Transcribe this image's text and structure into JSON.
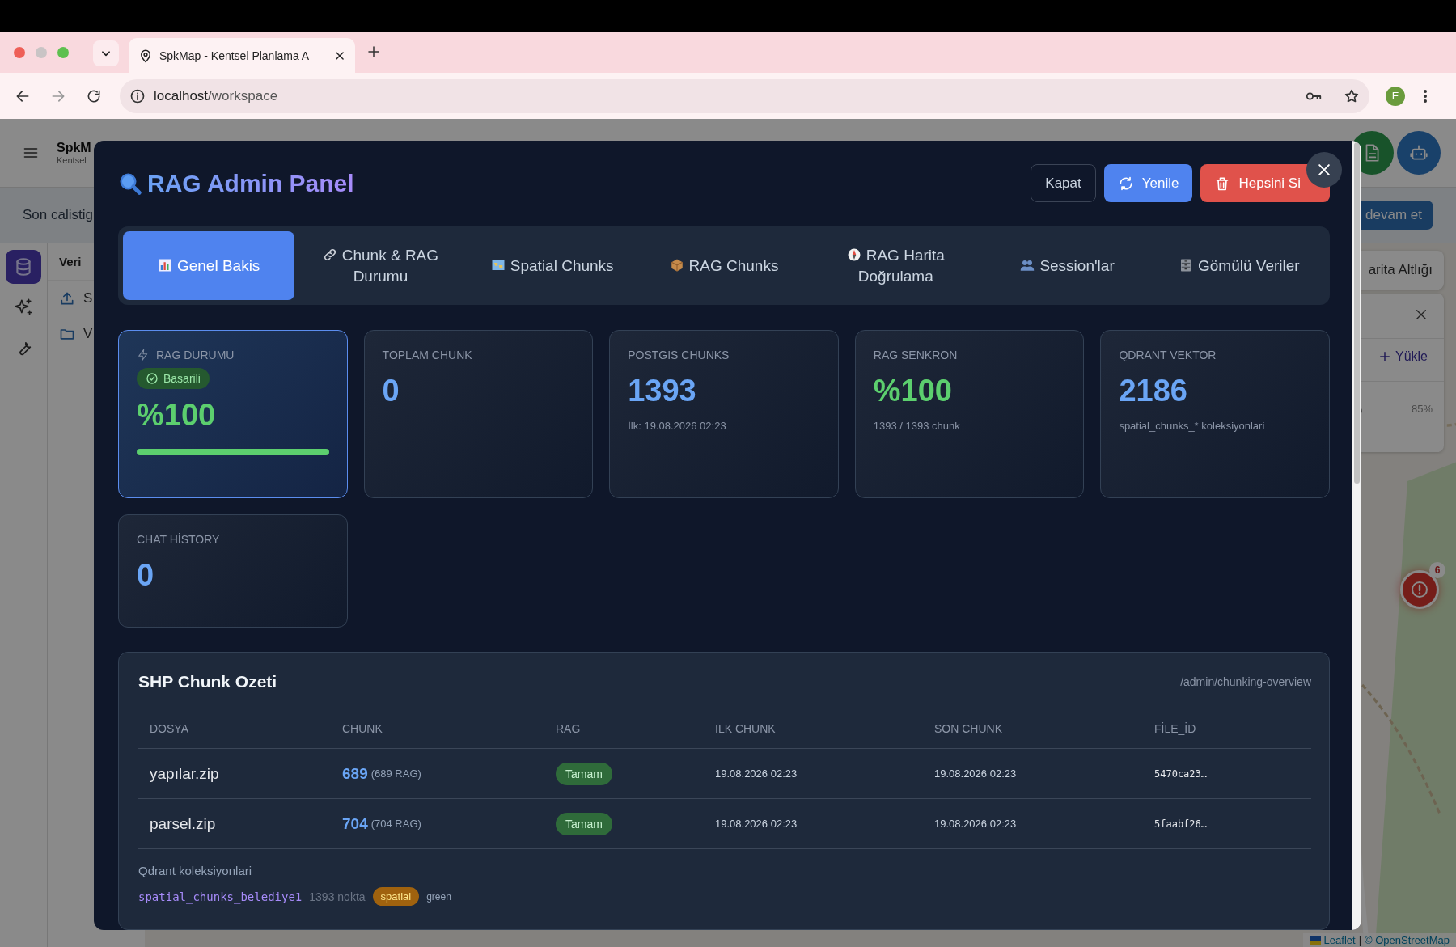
{
  "browser": {
    "tabs": [
      {
        "title": "SpkMap - Kentsel Planlama A",
        "selected": true
      }
    ],
    "url_host": "localhost",
    "url_path": "/workspace",
    "profile": "E"
  },
  "app": {
    "brand": "SpkM",
    "subtitle": "Kentsel",
    "banner": "Son calistig",
    "banner_action": "devam et",
    "rail": [
      {
        "kind": "database",
        "selected": true
      },
      {
        "kind": "sparkles",
        "selected": false
      },
      {
        "kind": "wrench",
        "selected": false
      }
    ],
    "sidebar": {
      "section": "Veri",
      "items": [
        {
          "kind": "upload",
          "label": "S"
        },
        {
          "kind": "folder",
          "label": "V"
        }
      ]
    },
    "layer_panel": {
      "title": "arita Altlığı",
      "upload": "Yükle",
      "opacity": "85%"
    },
    "alert_count": "6",
    "attribution": {
      "leaflet": "Leaflet",
      "separator": "|",
      "osm": "© OpenStreetMap"
    }
  },
  "modal": {
    "title": "RAG Admin Panel",
    "buttons": [
      {
        "kind": "outline",
        "label": "Kapat"
      },
      {
        "kind": "refresh",
        "label": "Yenile"
      },
      {
        "kind": "delete",
        "label": "Hepsini Si"
      }
    ],
    "tabs": [
      {
        "kind": "chart",
        "label": "Genel Bakis",
        "selected": true
      },
      {
        "kind": "link",
        "label": "Chunk & RAG Durumu",
        "selected": false
      },
      {
        "kind": "map",
        "label": "Spatial Chunks",
        "selected": false
      },
      {
        "kind": "box",
        "label": "RAG Chunks",
        "selected": false
      },
      {
        "kind": "compass",
        "label": "RAG Harita Doğrulama",
        "selected": false
      },
      {
        "kind": "people",
        "label": "Session'lar",
        "selected": false
      },
      {
        "kind": "cabinet",
        "label": "Gömülü Veriler",
        "selected": false
      }
    ],
    "stats": [
      {
        "kind": "status",
        "label": "RAG DURUMU",
        "badge": "Basarili",
        "value": "%100",
        "color": "#5ccf6e",
        "level": 1
      },
      {
        "kind": "plain",
        "label": "TOPLAM CHUNK",
        "value": "0",
        "color": "#6aa5f5"
      },
      {
        "kind": "plain",
        "label": "POSTGIS CHUNKS",
        "value": "1393",
        "sub": "İlk: 19.08.2026 02:23",
        "color": "#6aa5f5"
      },
      {
        "kind": "plain",
        "label": "RAG SENKRON",
        "value": "%100",
        "sub": "1393 / 1393 chunk",
        "color": "#5ccf6e"
      },
      {
        "kind": "plain",
        "label": "QDRANT VEKTOR",
        "value": "2186",
        "sub": "spatial_chunks_* koleksiyonlari",
        "color": "#6aa5f5"
      },
      {
        "kind": "plain",
        "label": "CHAT HİSTORY",
        "value": "0",
        "color": "#6aa5f5"
      }
    ],
    "summary": {
      "title": "SHP Chunk Ozeti",
      "endpoint": "/admin/chunking-overview",
      "columns": [
        "DOSYA",
        "CHUNK",
        "RAG",
        "ILK CHUNK",
        "SON CHUNK",
        "FİLE_İD"
      ],
      "rows": [
        {
          "file": "yapılar.zip",
          "chunk": "689",
          "chunk_rag": "(689 RAG)",
          "rag": "Tamam",
          "first": "19.08.2026 02:23",
          "last": "19.08.2026 02:23",
          "file_id": "5470ca23…"
        },
        {
          "file": "parsel.zip",
          "chunk": "704",
          "chunk_rag": "(704 RAG)",
          "rag": "Tamam",
          "first": "19.08.2026 02:23",
          "last": "19.08.2026 02:23",
          "file_id": "5faabf26…"
        }
      ],
      "collections_title": "Qdrant koleksiyonlari",
      "collections": [
        {
          "name": "spatial_chunks_belediye1",
          "count": "1393 nokta",
          "tag": "spatial",
          "status": "green"
        }
      ]
    }
  }
}
